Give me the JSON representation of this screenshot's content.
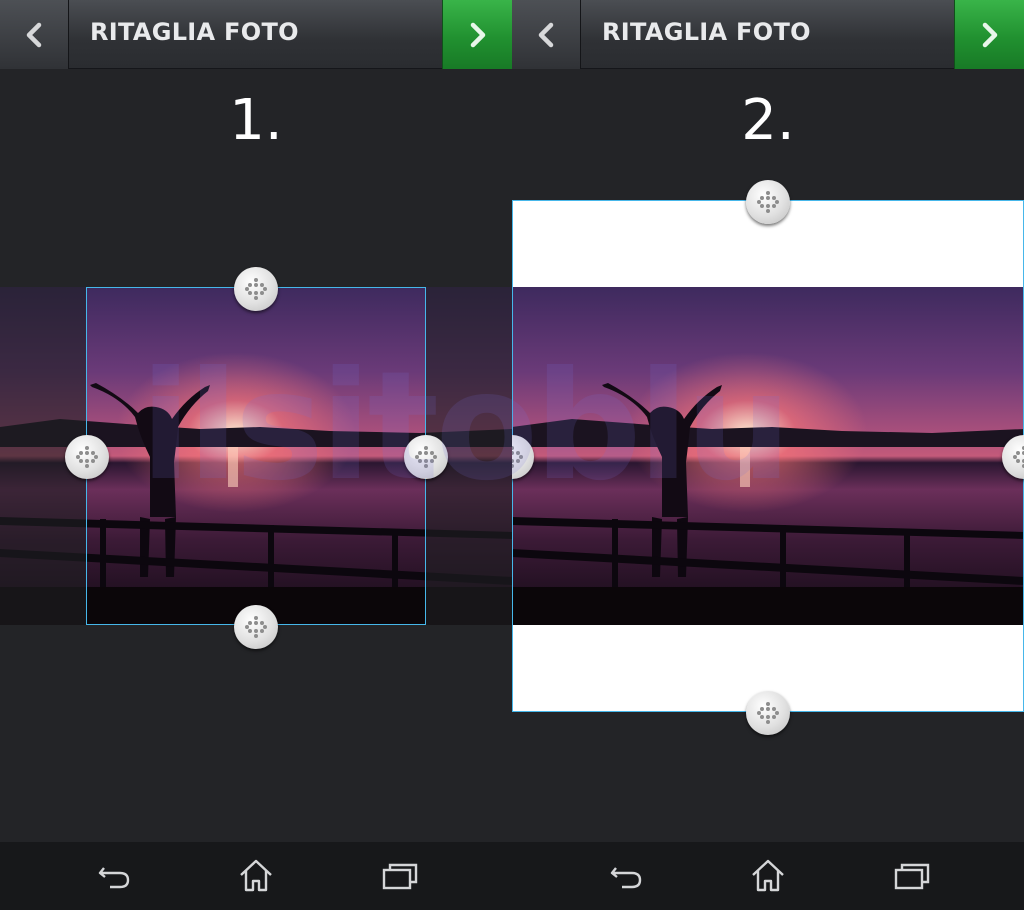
{
  "panels": [
    {
      "title": "RITAGLIA FOTO",
      "step": "1.",
      "nav": {
        "back": "back-icon",
        "next": "chevron-right-icon"
      }
    },
    {
      "title": "RITAGLIA FOTO",
      "step": "2.",
      "nav": {
        "back": "back-icon",
        "next": "chevron-right-icon"
      }
    }
  ],
  "watermark": "ilsitoblu",
  "system_nav": [
    "back-arrow-icon",
    "home-icon",
    "recent-apps-icon"
  ],
  "colors": {
    "accent_green": "#2aa33a",
    "crop_border": "#46b7ea",
    "background": "#232427"
  }
}
